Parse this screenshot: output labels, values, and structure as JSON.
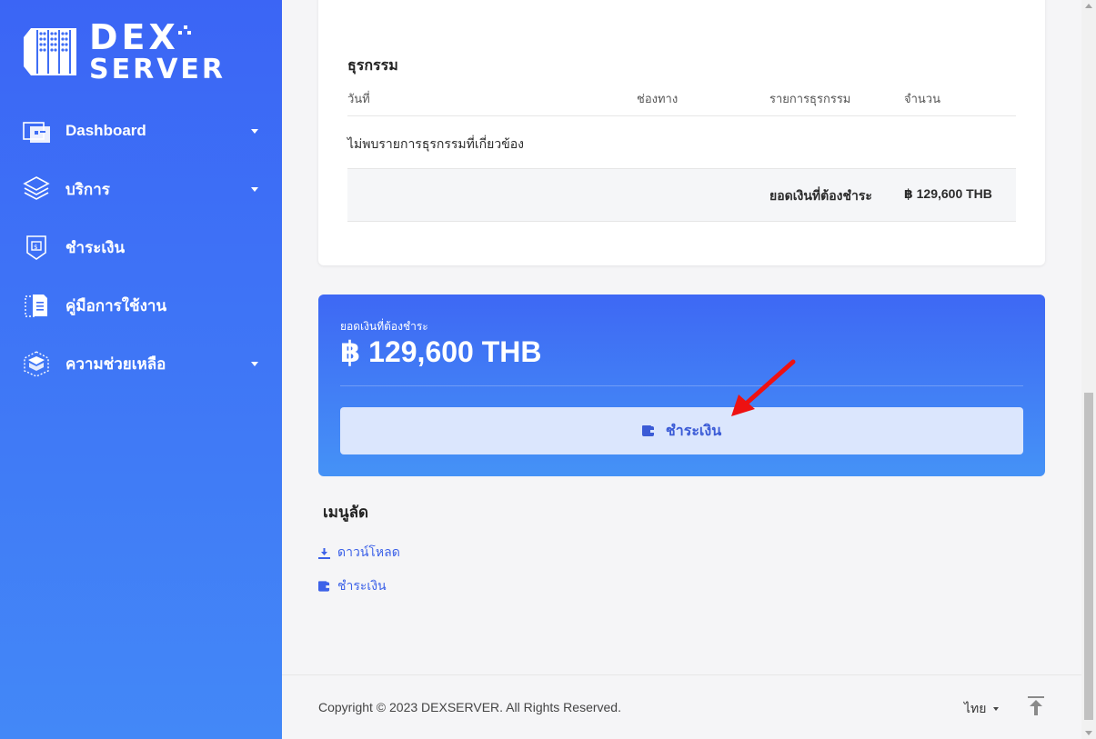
{
  "brand": {
    "line1": "DEX",
    "line2": "SERVER"
  },
  "sidebar": {
    "items": [
      {
        "label": "Dashboard",
        "icon": "dashboard-icon",
        "has_caret": true
      },
      {
        "label": "บริการ",
        "icon": "server-stack-icon",
        "has_caret": true
      },
      {
        "label": "ชำระเงิน",
        "icon": "wallet-icon",
        "has_caret": false
      },
      {
        "label": "คู่มือการใช้งาน",
        "icon": "document-icon",
        "has_caret": false
      },
      {
        "label": "ความช่วยเหลือ",
        "icon": "support-box-icon",
        "has_caret": true
      }
    ]
  },
  "transactions": {
    "title": "ธุรกรรม",
    "columns": [
      "วันที่",
      "ช่องทาง",
      "รายการธุรกรรม",
      "จำนวน"
    ],
    "empty_message": "ไม่พบรายการธุรกรรมที่เกี่ยวข้อง",
    "total_label": "ยอดเงินที่ต้องชำระ",
    "total_value": "฿ 129,600 THB"
  },
  "payment": {
    "caption": "ยอดเงินที่ต้องชำระ",
    "amount": "฿ 129,600 THB",
    "button_label": "ชำระเงิน",
    "button_icon": "wallet-icon"
  },
  "shortcuts": {
    "title": "เมนูลัด",
    "links": [
      {
        "label": "ดาวน์โหลด",
        "icon": "download-icon"
      },
      {
        "label": "ชำระเงิน",
        "icon": "wallet-icon"
      }
    ]
  },
  "footer": {
    "copyright": "Copyright © 2023 DEXSERVER. All Rights Reserved.",
    "language": "ไทย"
  },
  "colors": {
    "sidebar_top": "#3b65f5",
    "sidebar_bottom": "#4388f7",
    "accent": "#3d62e8",
    "button_bg": "#dbe6fd",
    "annotation_arrow": "#ee1111"
  }
}
